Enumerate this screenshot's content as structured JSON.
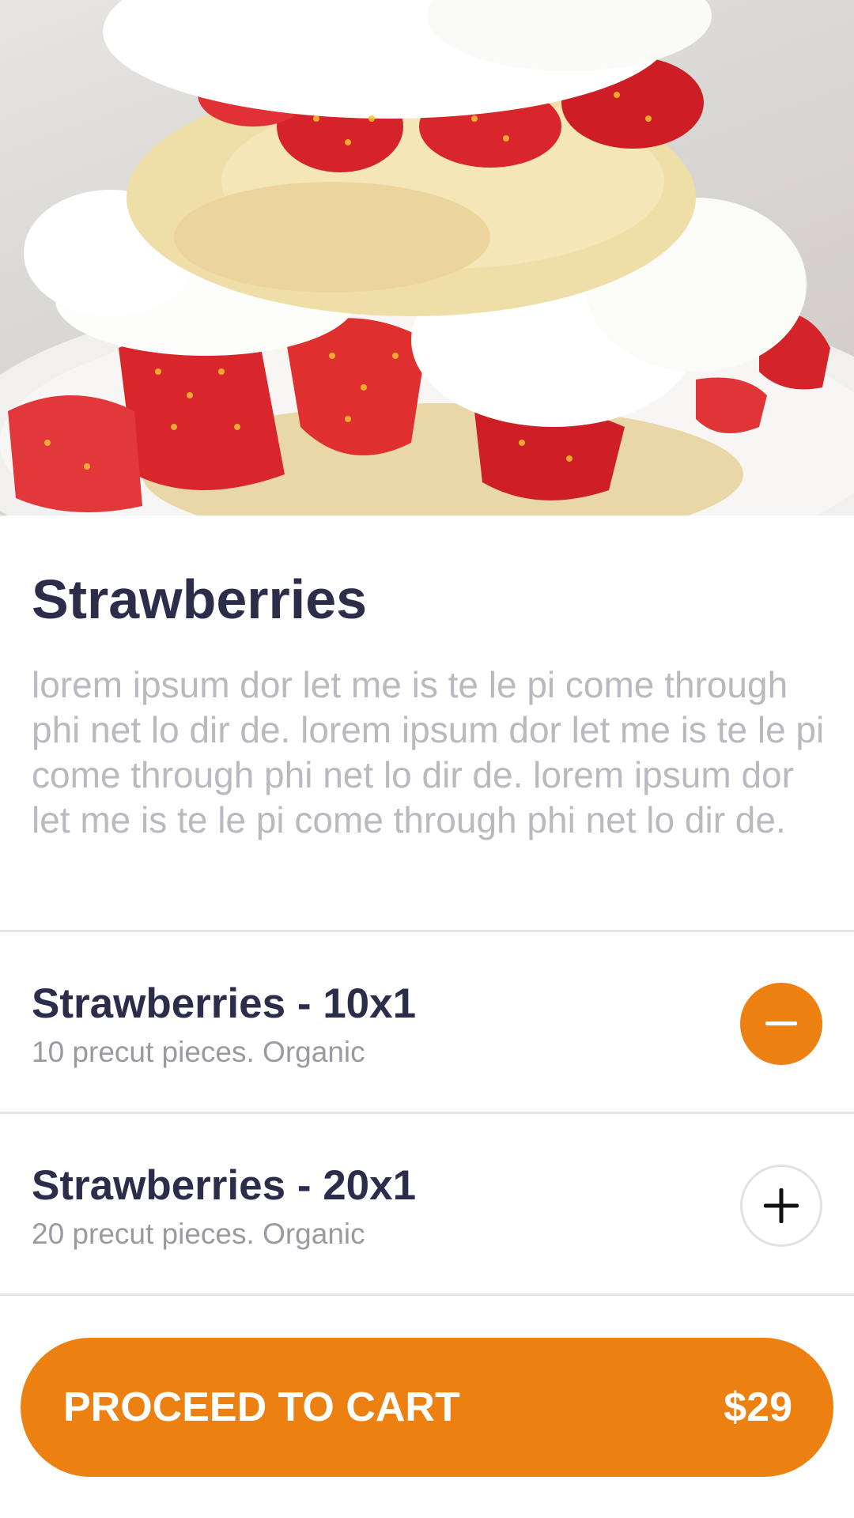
{
  "product": {
    "image": "strawberry-shortcake-photo",
    "title": "Strawberries",
    "description": "lorem ipsum dor let me is te le pi come through phi net lo dir de. lorem ipsum dor let me is te le pi come through phi net lo dir de. lorem ipsum dor let me is te le pi come through phi net lo dir de."
  },
  "options": [
    {
      "name": "Strawberries - 10x1",
      "detail": "10 precut pieces. Organic",
      "selected": true,
      "icon": "minus-icon"
    },
    {
      "name": "Strawberries - 20x1",
      "detail": "20 precut pieces. Organic",
      "selected": false,
      "icon": "plus-icon"
    }
  ],
  "cart": {
    "label": "PROCEED TO CART",
    "price": "$29"
  },
  "colors": {
    "accent": "#ec8011",
    "title": "#2b2d4a",
    "muted": "#b9b9bf",
    "divider": "#e4e4e7"
  }
}
